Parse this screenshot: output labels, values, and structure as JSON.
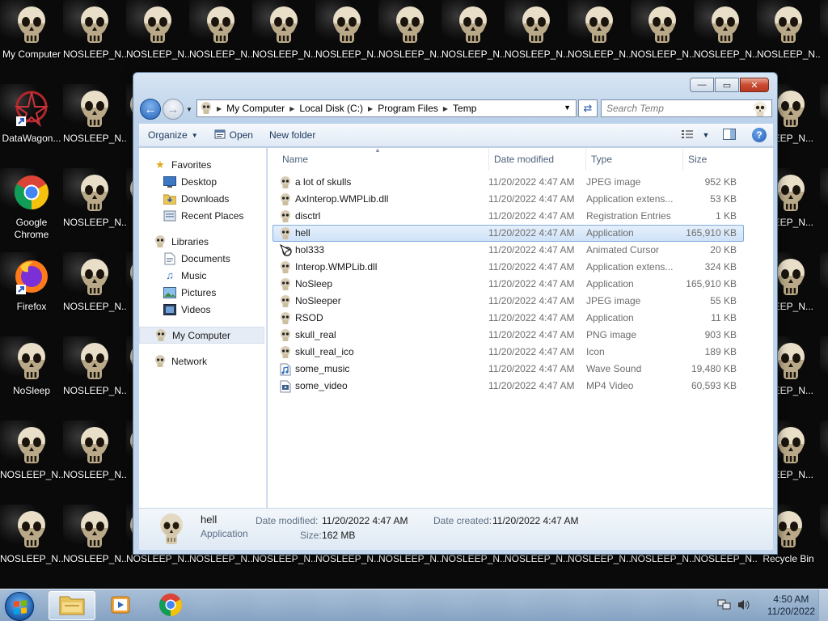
{
  "desktop": {
    "icons": [
      {
        "label": "My Computer",
        "glyph": "skull-icon"
      },
      {
        "label": "NOSLEEP_N...",
        "glyph": "skull-icon"
      },
      {
        "label": "DataWagon...",
        "glyph": "datawagon-icon"
      },
      {
        "label": "NOSLEEP_N...",
        "glyph": "skull-icon"
      },
      {
        "label": "Google Chrome",
        "glyph": "chrome-icon"
      },
      {
        "label": "NOSLEEP_N...",
        "glyph": "skull-icon"
      },
      {
        "label": "Firefox",
        "glyph": "firefox-icon"
      },
      {
        "label": "NOSLEEP_N...",
        "glyph": "skull-icon"
      },
      {
        "label": "NoSleep",
        "glyph": "skull-icon"
      },
      {
        "label": "NOSLEEP_N...",
        "glyph": "skull-icon"
      },
      {
        "label": "NOSLEEP_N...",
        "glyph": "skull-icon"
      },
      {
        "label": "NOSLEEP_N...",
        "glyph": "skull-icon"
      },
      {
        "label": "NOSLEEP_N...",
        "glyph": "skull-icon"
      },
      {
        "label": "NOSLEEP_N...",
        "glyph": "skull-icon"
      },
      {
        "label": "Recycle Bin",
        "glyph": "skull-icon"
      }
    ],
    "top_row_label": "NOSLEEP_N...",
    "right_col_label": "LEEP_N...",
    "chrome_line1": "Google",
    "chrome_line2": "Chrome"
  },
  "window": {
    "address": {
      "crumbs": [
        "My Computer",
        "Local Disk (C:)",
        "Program Files",
        "Temp"
      ]
    },
    "search": {
      "placeholder": "Search Temp"
    },
    "toolbar": {
      "organize": "Organize",
      "open": "Open",
      "new_folder": "New folder"
    },
    "nav": {
      "favorites": "Favorites",
      "desktop": "Desktop",
      "downloads": "Downloads",
      "recent_places": "Recent Places",
      "libraries": "Libraries",
      "documents": "Documents",
      "music": "Music",
      "pictures": "Pictures",
      "videos": "Videos",
      "my_computer": "My Computer",
      "network": "Network"
    },
    "columns": {
      "name": "Name",
      "date": "Date modified",
      "type": "Type",
      "size": "Size"
    },
    "files": [
      {
        "name": "a lot of skulls",
        "date": "11/20/2022 4:47 AM",
        "type": "JPEG image",
        "size": "952 KB",
        "icon": "skull-file-icon"
      },
      {
        "name": "AxInterop.WMPLib.dll",
        "date": "11/20/2022 4:47 AM",
        "type": "Application extens...",
        "size": "53 KB",
        "icon": "skull-file-icon"
      },
      {
        "name": "disctrl",
        "date": "11/20/2022 4:47 AM",
        "type": "Registration Entries",
        "size": "1 KB",
        "icon": "skull-file-icon"
      },
      {
        "name": "hell",
        "date": "11/20/2022 4:47 AM",
        "type": "Application",
        "size": "165,910 KB",
        "icon": "skull-file-icon",
        "selected": true
      },
      {
        "name": "hol333",
        "date": "11/20/2022 4:47 AM",
        "type": "Animated Cursor",
        "size": "20 KB",
        "icon": "cursor-file-icon"
      },
      {
        "name": "Interop.WMPLib.dll",
        "date": "11/20/2022 4:47 AM",
        "type": "Application extens...",
        "size": "324 KB",
        "icon": "skull-file-icon"
      },
      {
        "name": "NoSleep",
        "date": "11/20/2022 4:47 AM",
        "type": "Application",
        "size": "165,910 KB",
        "icon": "skull-file-icon"
      },
      {
        "name": "NoSleeper",
        "date": "11/20/2022 4:47 AM",
        "type": "JPEG image",
        "size": "55 KB",
        "icon": "skull-file-icon"
      },
      {
        "name": "RSOD",
        "date": "11/20/2022 4:47 AM",
        "type": "Application",
        "size": "11 KB",
        "icon": "skull-file-icon"
      },
      {
        "name": "skull_real",
        "date": "11/20/2022 4:47 AM",
        "type": "PNG image",
        "size": "903 KB",
        "icon": "skull-file-icon"
      },
      {
        "name": "skull_real_ico",
        "date": "11/20/2022 4:47 AM",
        "type": "Icon",
        "size": "189 KB",
        "icon": "skull-file-icon"
      },
      {
        "name": "some_music",
        "date": "11/20/2022 4:47 AM",
        "type": "Wave Sound",
        "size": "19,480 KB",
        "icon": "music-file-icon"
      },
      {
        "name": "some_video",
        "date": "11/20/2022 4:47 AM",
        "type": "MP4 Video",
        "size": "60,593 KB",
        "icon": "video-file-icon"
      }
    ],
    "details": {
      "name": "hell",
      "type": "Application",
      "date_modified_label": "Date modified:",
      "date_modified": "11/20/2022 4:47 AM",
      "date_created_label": "Date created:",
      "date_created": "11/20/2022 4:47 AM",
      "size_label": "Size:",
      "size": "162 MB"
    }
  },
  "taskbar": {
    "time": "4:50 AM",
    "date": "11/20/2022"
  },
  "colors": {
    "selection": "#cfe2f8",
    "accent": "#2462b6"
  }
}
